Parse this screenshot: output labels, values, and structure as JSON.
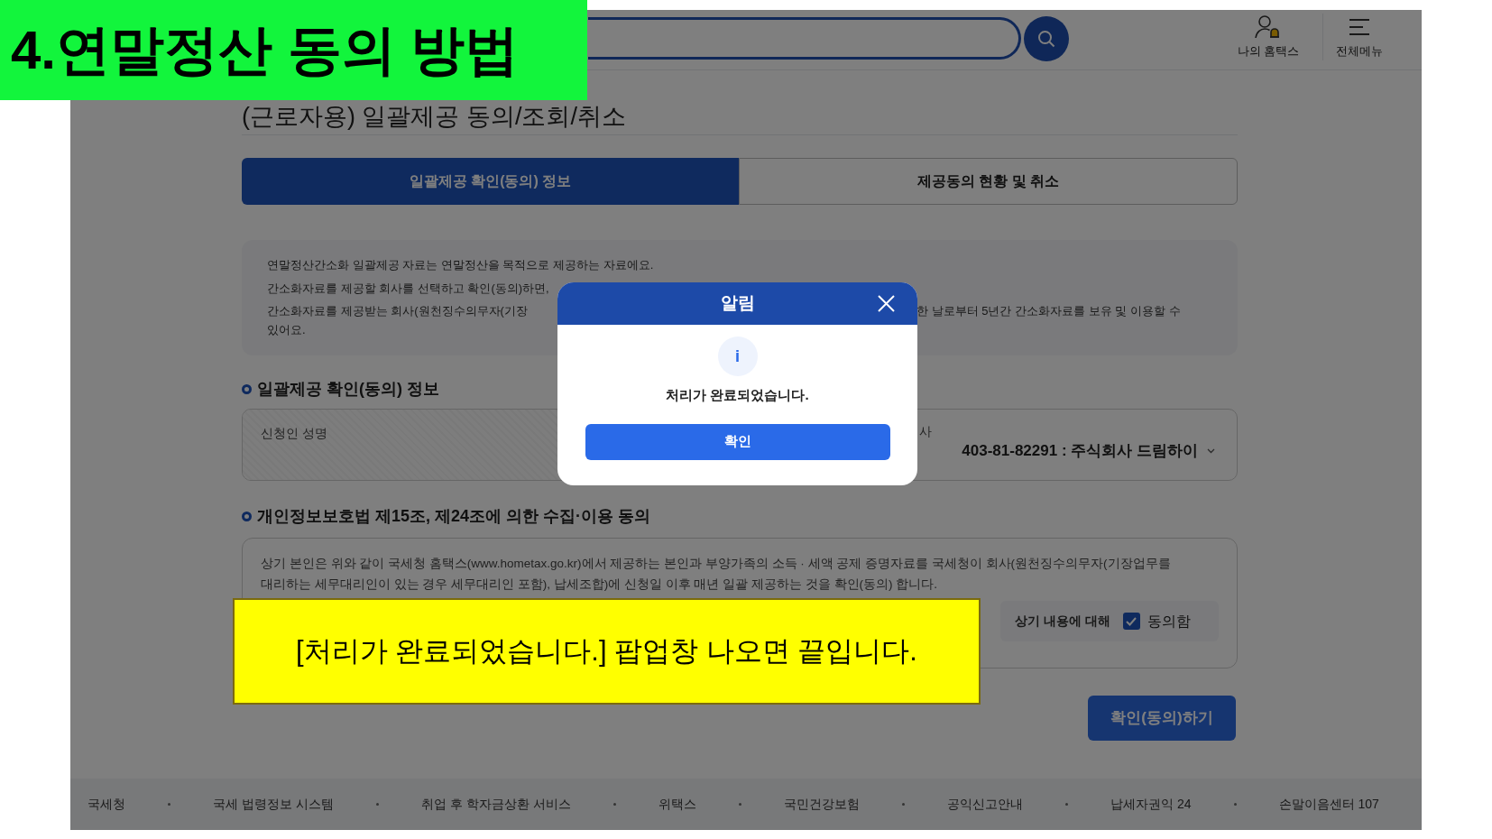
{
  "annotation_title": "4.연말정산 동의 방법",
  "header": {
    "nav": [
      {
        "kind": "myhome",
        "label": "나의 홈택스"
      },
      {
        "kind": "menu",
        "label": "전체메뉴"
      }
    ]
  },
  "page_title": "(근로자용) 일괄제공 동의/조회/취소",
  "tabs": [
    {
      "label": "일괄제공 확인(동의) 정보",
      "selected": true
    },
    {
      "label": "제공동의 현황 및 취소",
      "selected": false
    }
  ],
  "notice": {
    "lines": [
      {
        "left": "연말정산간소화 일괄제공 자료는 연말정산을 목적으로 제공하는 자료에요."
      },
      {
        "left": "간소화자료를 제공할 회사를 선택하고 확인(동의)하면,"
      },
      {
        "left": "간소화자료를 제공받는 회사(원천징수의무자(기장",
        "right": "한 날로부터 5년간 간소화자료를 보유 및 이용할 수",
        "continuation": "있어요."
      }
    ]
  },
  "section1": {
    "heading": "일괄제공 확인(동의) 정보",
    "applicant_label": "신청인 성명",
    "company_label": "사",
    "company_value": "403-81-82291 : 주식회사 드림하이"
  },
  "section2": {
    "heading": "개인정보보호법 제15조, 제24조에 의한 수집·이용 동의",
    "text": "상기 본인은 위와 같이 국세청 홈택스(www.hometax.go.kr)에서 제공하는 본인과 부양가족의 소득 · 세액 공제 증명자료를 국세청이 회사(원천징수의무자(기장업무를 대리하는 세무대리인이 있는 경우 세무대리인 포함), 납세조합)에 신청일 이후 매년 일괄 제공하는 것을 확인(동의) 합니다.",
    "agree_prompt": "상기 내용에 대해",
    "agree_label": "동의함",
    "agreed": true
  },
  "submit_button": "확인(동의)하기",
  "footer": [
    "국세청",
    "국세 법령정보 시스템",
    "취업 후 학자금상환 서비스",
    "위택스",
    "국민건강보험",
    "공익신고안내",
    "납세자권익 24",
    "손말이음센터 107"
  ],
  "dialog": {
    "title": "알림",
    "icon": "i",
    "message": "처리가 완료되었습니다.",
    "button": "확인"
  },
  "annotation_note": "[처리가 완료되었습니다.] 팝업창 나오면 끝입니다."
}
